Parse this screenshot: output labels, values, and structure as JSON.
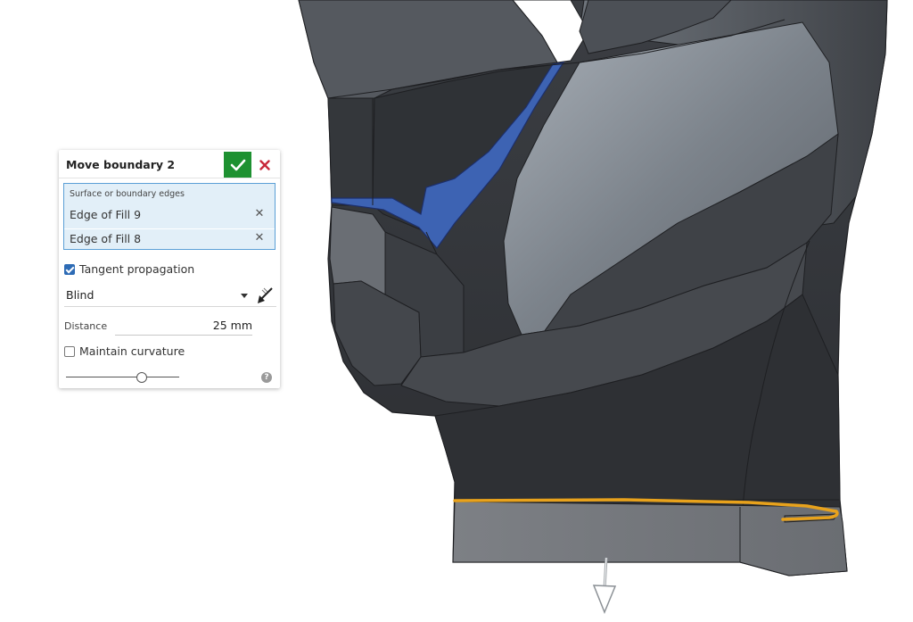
{
  "dialog": {
    "title": "Move boundary 2",
    "accept_icon": "checkmark-icon",
    "cancel_icon": "close-icon",
    "accept_color": "#1e9131",
    "cancel_color": "#c8283a",
    "selection": {
      "label": "Surface or boundary edges",
      "items": [
        {
          "label": "Edge of Fill 9"
        },
        {
          "label": "Edge of Fill 8"
        }
      ]
    },
    "tangent_propagation": {
      "label": "Tangent propagation",
      "checked": true
    },
    "end_type": {
      "value": "Blind",
      "flip_icon": "flip-direction-arrow-icon"
    },
    "distance": {
      "label": "Distance",
      "value": "25 mm"
    },
    "maintain_curvature": {
      "label": "Maintain curvature",
      "checked": false
    },
    "slider": {
      "position": 0.69
    },
    "help_icon": "help-icon"
  },
  "viewport": {
    "selected_face_color": "#3d63b3",
    "selected_edge_color": "#e8a21c",
    "body_color": "#3a3d42"
  }
}
